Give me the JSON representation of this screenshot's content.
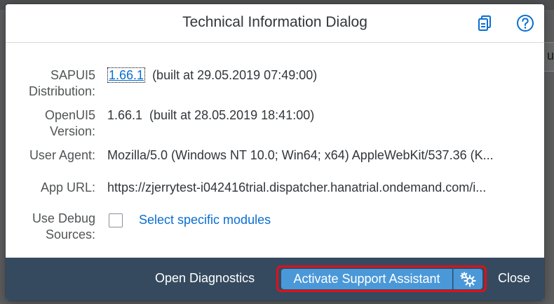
{
  "dialog": {
    "title": "Technical Information Dialog",
    "icons": {
      "copy": "copy-icon",
      "help": "help-icon"
    }
  },
  "rows": {
    "distribution": {
      "label_line1": "SAPUI5",
      "label_line2": "Distribution:",
      "version": "1.66.1",
      "built": "(built at 29.05.2019 07:49:00)"
    },
    "openui5": {
      "label_line1": "OpenUI5",
      "label_line2": "Version:",
      "value": "1.66.1  (built at 28.05.2019 18:41:00)"
    },
    "user_agent": {
      "label": "User Agent:",
      "value": "Mozilla/5.0 (Windows NT 10.0; Win64; x64) AppleWebKit/537.36 (K..."
    },
    "app_url": {
      "label": "App URL:",
      "value": "https://zjerrytest-i042416trial.dispatcher.hanatrial.ondemand.com/i..."
    },
    "debug": {
      "label_line1": "Use Debug",
      "label_line2": "Sources:",
      "checked": false,
      "link": "Select specific modules"
    }
  },
  "footer": {
    "open_diagnostics": "Open Diagnostics",
    "activate_support": "Activate Support Assistant",
    "gear_icon": "gears-icon",
    "close": "Close"
  },
  "background": {
    "panel_text": "ur"
  },
  "colors": {
    "footer": "#354a5f",
    "accent": "#0a6ed1",
    "button": "#4a98d8",
    "highlight": "#e0101a"
  }
}
